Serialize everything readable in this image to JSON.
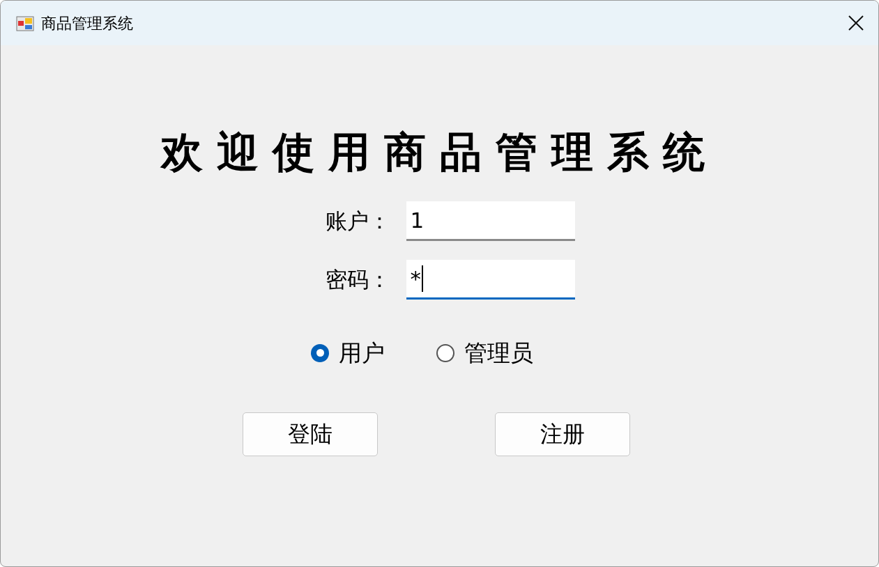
{
  "window": {
    "title": "商品管理系统"
  },
  "heading": "欢迎使用商品管理系统",
  "fields": [
    {
      "label": "账户：",
      "value": "1",
      "focused": false
    },
    {
      "label": "密码：",
      "value": "*",
      "focused": true
    }
  ],
  "roles": [
    {
      "label": "用户",
      "selected": true
    },
    {
      "label": "管理员",
      "selected": false
    }
  ],
  "buttons": [
    "登陆",
    "注册"
  ]
}
